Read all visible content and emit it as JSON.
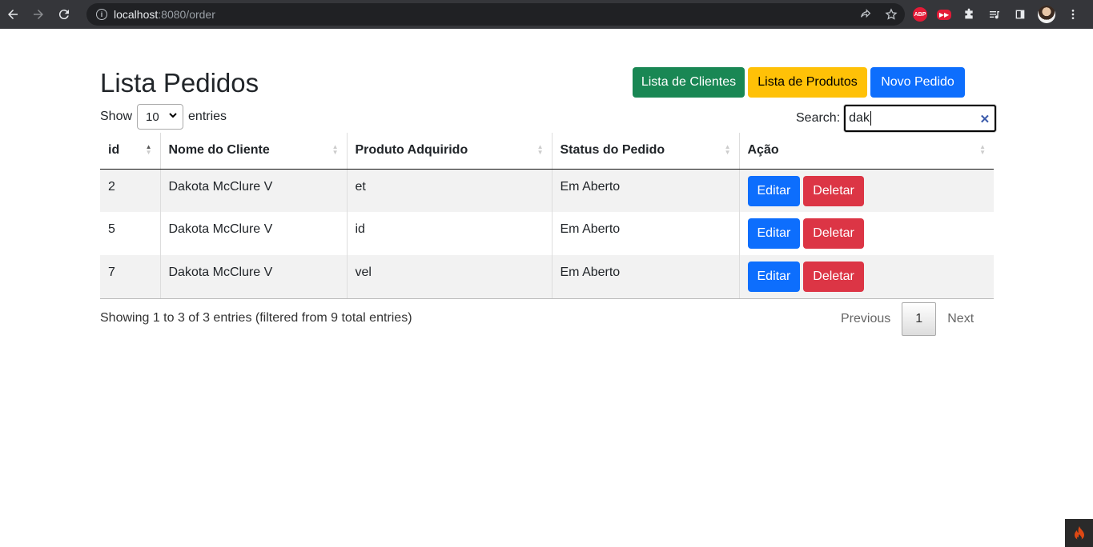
{
  "browser": {
    "url_host": "localhost",
    "url_rest": ":8080/order",
    "extensions": [
      "ABP",
      "▶▶"
    ]
  },
  "page": {
    "title": "Lista Pedidos",
    "buttons": {
      "clients": "Lista de Clientes",
      "products": "Lista de Produtos",
      "new_order": "Novo Pedido"
    },
    "length": {
      "before": "Show",
      "value": "10",
      "after": "entries"
    },
    "search": {
      "label": "Search:",
      "value": "dak"
    },
    "table": {
      "headers": [
        "id",
        "Nome do Cliente",
        "Produto Adquirido",
        "Status do Pedido",
        "Ação"
      ],
      "rows": [
        {
          "id": "2",
          "client": "Dakota McClure V",
          "product": "et",
          "status": "Em Aberto"
        },
        {
          "id": "5",
          "client": "Dakota McClure V",
          "product": "id",
          "status": "Em Aberto"
        },
        {
          "id": "7",
          "client": "Dakota McClure V",
          "product": "vel",
          "status": "Em Aberto"
        }
      ],
      "edit_label": "Editar",
      "delete_label": "Deletar"
    },
    "info": "Showing 1 to 3 of 3 entries (filtered from 9 total entries)",
    "pagination": {
      "previous": "Previous",
      "current": "1",
      "next": "Next"
    }
  },
  "colors": {
    "success": "#198754",
    "warning": "#ffc107",
    "primary": "#0d6efd",
    "danger": "#dc3545"
  }
}
